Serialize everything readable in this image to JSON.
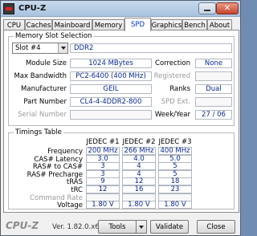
{
  "window": {
    "title": "CPU-Z",
    "close_glyph": "✕"
  },
  "tabs": [
    "CPU",
    "Caches",
    "Mainboard",
    "Memory",
    "SPD",
    "Graphics",
    "Bench",
    "About"
  ],
  "slot_selection": {
    "group_label": "Memory Slot Selection",
    "selected_slot": "Slot #4",
    "memory_type": "DDR2",
    "rows": {
      "module_size": {
        "label": "Module Size",
        "value": "1024 MBytes"
      },
      "max_bandwidth": {
        "label": "Max Bandwidth",
        "value": "PC2-6400 (400 MHz)"
      },
      "manufacturer": {
        "label": "Manufacturer",
        "value": "GEIL"
      },
      "part_number": {
        "label": "Part Number",
        "value": "CL4-4-4DDR2-800"
      },
      "serial_number": {
        "label": "Serial Number",
        "value": ""
      }
    },
    "right": {
      "correction": {
        "label": "Correction",
        "value": "None"
      },
      "registered": {
        "label": "Registered",
        "value": ""
      },
      "ranks": {
        "label": "Ranks",
        "value": "Dual"
      },
      "spd_ext": {
        "label": "SPD Ext.",
        "value": ""
      },
      "week_year": {
        "label": "Week/Year",
        "value": "27 / 06"
      }
    }
  },
  "timings": {
    "group_label": "Timings Table",
    "columns": [
      "JEDEC #1",
      "JEDEC #2",
      "JEDEC #3"
    ],
    "rows": [
      {
        "label": "Frequency",
        "values": [
          "200 MHz",
          "266 MHz",
          "400 MHz"
        ],
        "enabled": true
      },
      {
        "label": "CAS# Latency",
        "values": [
          "3.0",
          "4.0",
          "5.0"
        ],
        "enabled": true
      },
      {
        "label": "RAS# to CAS#",
        "values": [
          "3",
          "4",
          "5"
        ],
        "enabled": true
      },
      {
        "label": "RAS# Precharge",
        "values": [
          "3",
          "4",
          "5"
        ],
        "enabled": true
      },
      {
        "label": "tRAS",
        "values": [
          "9",
          "12",
          "18"
        ],
        "enabled": true
      },
      {
        "label": "tRC",
        "values": [
          "12",
          "16",
          "23"
        ],
        "enabled": true
      },
      {
        "label": "Command Rate",
        "values": [
          "",
          "",
          ""
        ],
        "enabled": false
      },
      {
        "label": "Voltage",
        "values": [
          "1.80 V",
          "1.80 V",
          "1.80 V"
        ],
        "enabled": true
      }
    ]
  },
  "footer": {
    "brand": "CPU-Z",
    "version": "Ver. 1.82.0.x64",
    "tools_label": "Tools",
    "validate_label": "Validate",
    "close_label": "Close"
  },
  "colors": {
    "value_text": "#0b2a94",
    "active_tab_text": "#0033cc"
  }
}
